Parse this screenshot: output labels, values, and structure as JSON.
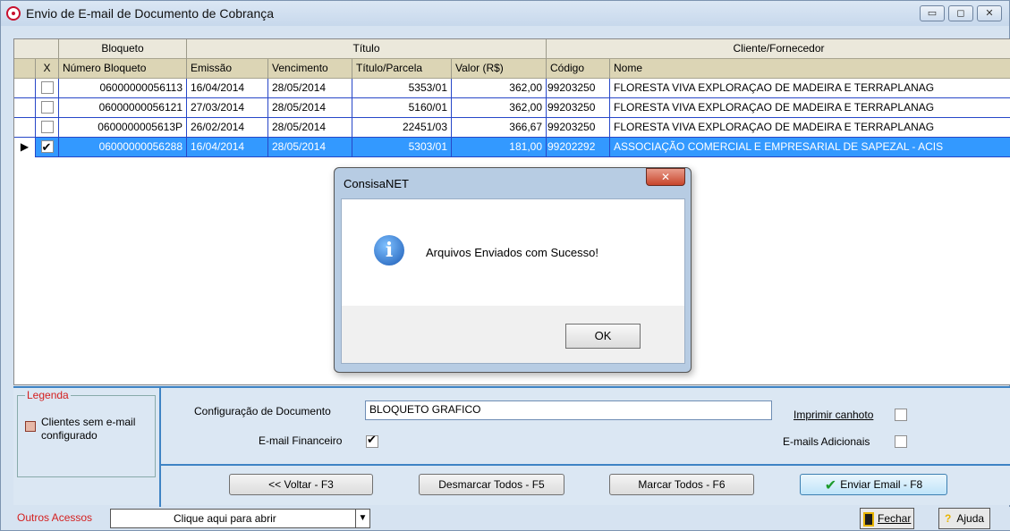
{
  "window": {
    "title": "Envio de E-mail de Documento de Cobrança",
    "controls": {
      "minimize": "▭",
      "maximize": "◻",
      "close": "✕"
    }
  },
  "grid": {
    "group_headers": [
      "Bloqueto",
      "Título",
      "Cliente/Fornecedor"
    ],
    "columns": [
      "X",
      "Número Bloqueto",
      "Emissão",
      "Vencimento",
      "Título/Parcela",
      "Valor (R$)",
      "Código",
      "Nome"
    ],
    "rows": [
      {
        "checked": false,
        "numero": "06000000056113",
        "emissao": "16/04/2014",
        "vencimento": "28/05/2014",
        "titulo": "5353/01",
        "valor": "362,00",
        "codigo": "99203250",
        "nome": "FLORESTA VIVA EXPLORAÇAO DE MADEIRA E TERRAPLANAG"
      },
      {
        "checked": false,
        "numero": "06000000056121",
        "emissao": "27/03/2014",
        "vencimento": "28/05/2014",
        "titulo": "5160/01",
        "valor": "362,00",
        "codigo": "99203250",
        "nome": "FLORESTA VIVA EXPLORAÇAO DE MADEIRA E TERRAPLANAG"
      },
      {
        "checked": false,
        "numero": "0600000005613P",
        "emissao": "26/02/2014",
        "vencimento": "28/05/2014",
        "titulo": "22451/03",
        "valor": "366,67",
        "codigo": "99203250",
        "nome": "FLORESTA VIVA EXPLORAÇAO DE MADEIRA E TERRAPLANAG"
      },
      {
        "checked": true,
        "selected": true,
        "numero": "06000000056288",
        "emissao": "16/04/2014",
        "vencimento": "28/05/2014",
        "titulo": "5303/01",
        "valor": "181,00",
        "codigo": "99202292",
        "nome": "ASSOCIAÇÃO COMERCIAL E EMPRESARIAL DE SAPEZAL - ACIS"
      }
    ]
  },
  "legend": {
    "title": "Legenda",
    "item": "Clientes sem e-mail configurado",
    "item_line1": "Clientes sem e-mail",
    "item_line2": "configurado"
  },
  "form": {
    "config_label": "Configuração de Documento",
    "config_value": "BLOQUETO GRAFICO",
    "email_fin_label": "E-mail Financeiro",
    "email_fin_checked": true,
    "imprimir_label": "Imprimir canhoto",
    "emails_adic_label": "E-mails Adicionais"
  },
  "buttons": {
    "voltar": "<< Voltar - F3",
    "desmarcar": "Desmarcar Todos - F5",
    "marcar": "Marcar Todos - F6",
    "enviar": "Enviar Email - F8"
  },
  "statusbar": {
    "outros_label": "Outros Acessos",
    "combo_value": "Clique aqui para abrir",
    "fechar": "Fechar",
    "ajuda": "Ajuda"
  },
  "dialog": {
    "title": "ConsisaNET",
    "message": "Arquivos Enviados com Sucesso!",
    "ok": "OK"
  },
  "colors": {
    "selection": "#3399ff",
    "accent_red": "#d42020",
    "panel_blue": "#3e83c4"
  }
}
